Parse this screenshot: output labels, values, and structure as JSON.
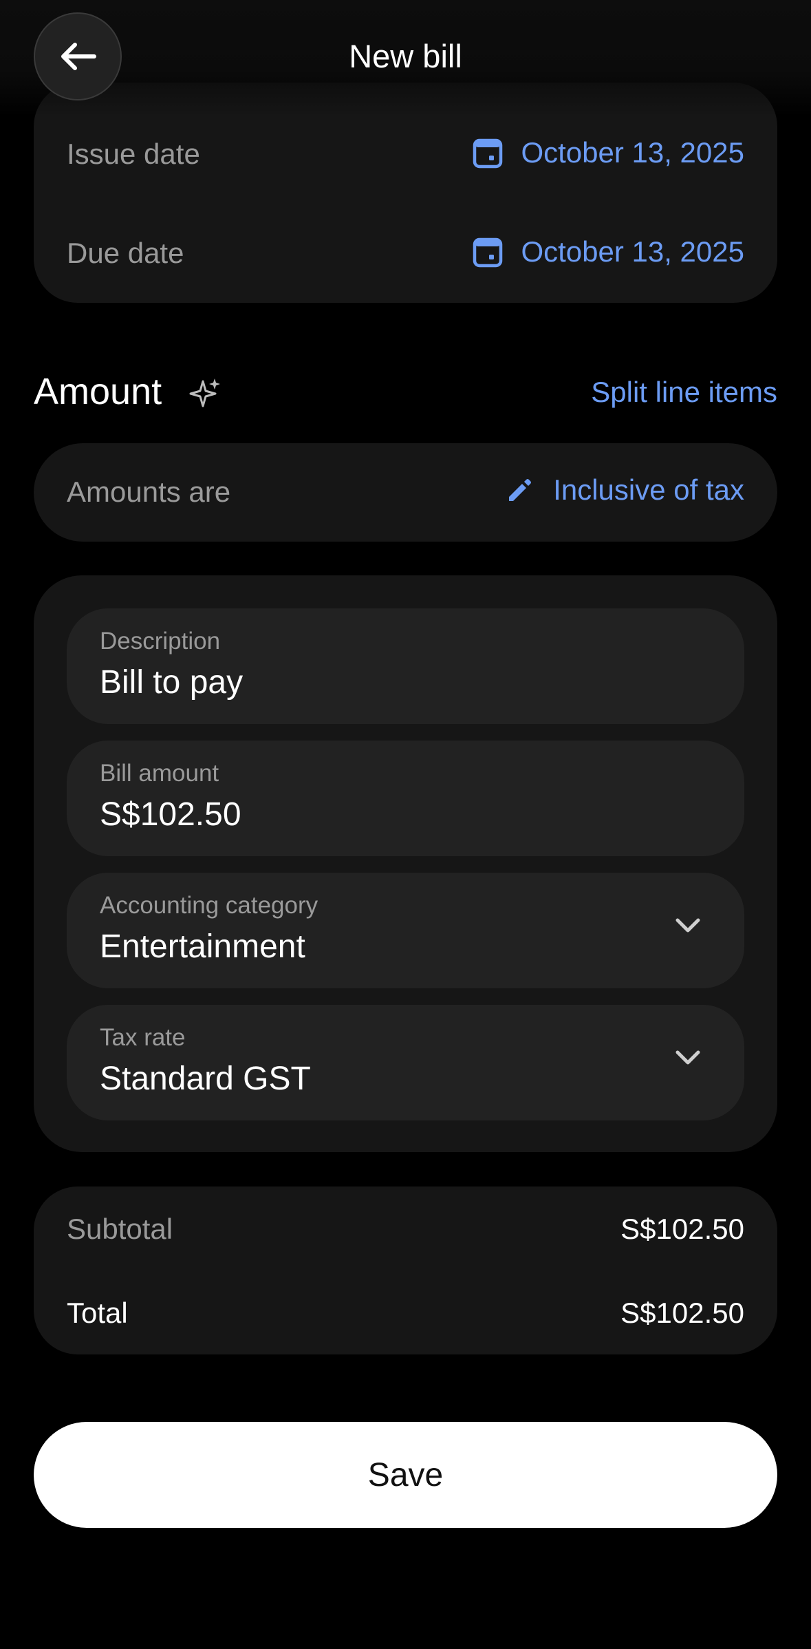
{
  "header": {
    "title": "New bill"
  },
  "dates": {
    "issue_label": "Issue date",
    "issue_value": "October 13, 2025",
    "due_label": "Due date",
    "due_value": "October 13, 2025"
  },
  "amount_section": {
    "title": "Amount",
    "split_link": "Split line items",
    "amounts_are_label": "Amounts are",
    "amounts_are_value": "Inclusive of tax"
  },
  "fields": {
    "description_label": "Description",
    "description_value": "Bill to pay",
    "bill_amount_label": "Bill amount",
    "bill_amount_value": "S$102.50",
    "category_label": "Accounting category",
    "category_value": "Entertainment",
    "tax_rate_label": "Tax rate",
    "tax_rate_value": "Standard GST"
  },
  "totals": {
    "subtotal_label": "Subtotal",
    "subtotal_value": "S$102.50",
    "total_label": "Total",
    "total_value": "S$102.50"
  },
  "actions": {
    "save_label": "Save"
  },
  "icons": {
    "back": "arrow-left-icon",
    "calendar": "calendar-icon",
    "sparkle": "sparkle-icon",
    "edit": "pencil-icon",
    "dropdown": "chevron-down-icon"
  },
  "colors": {
    "accent": "#6c9cf4",
    "background": "#000000",
    "card": "#161616",
    "field": "#222222"
  }
}
